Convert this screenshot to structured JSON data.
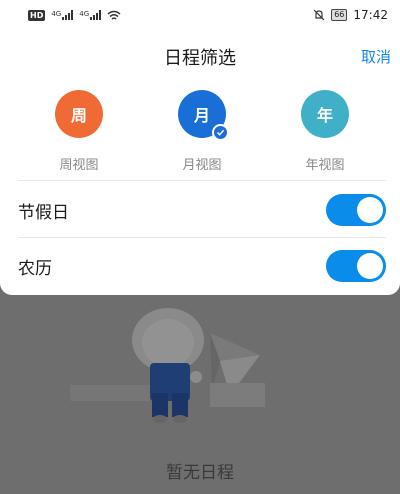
{
  "status_bar": {
    "hd": "HD",
    "gen1": "4G",
    "gen2": "4G",
    "battery": "66",
    "time": "17:42",
    "icons": [
      "hd-icon",
      "signal-icon",
      "signal-icon",
      "wifi-icon",
      "mute-icon",
      "battery-icon"
    ]
  },
  "header": {
    "title": "日程筛选",
    "cancel_label": "取消"
  },
  "views": [
    {
      "glyph": "周",
      "label": "周视图",
      "color": "#f06a35",
      "selected": false
    },
    {
      "glyph": "月",
      "label": "月视图",
      "color": "#1a6fd6",
      "selected": true
    },
    {
      "glyph": "年",
      "label": "年视图",
      "color": "#3fb0c7",
      "selected": false
    }
  ],
  "toggles": [
    {
      "label": "节假日",
      "on": true
    },
    {
      "label": "农历",
      "on": true
    }
  ],
  "colors": {
    "accent": "#1688e6",
    "toggle_on": "#0a8dea",
    "overlay": "#6e6e6e"
  },
  "background": {
    "empty_text": "暂无日程"
  }
}
